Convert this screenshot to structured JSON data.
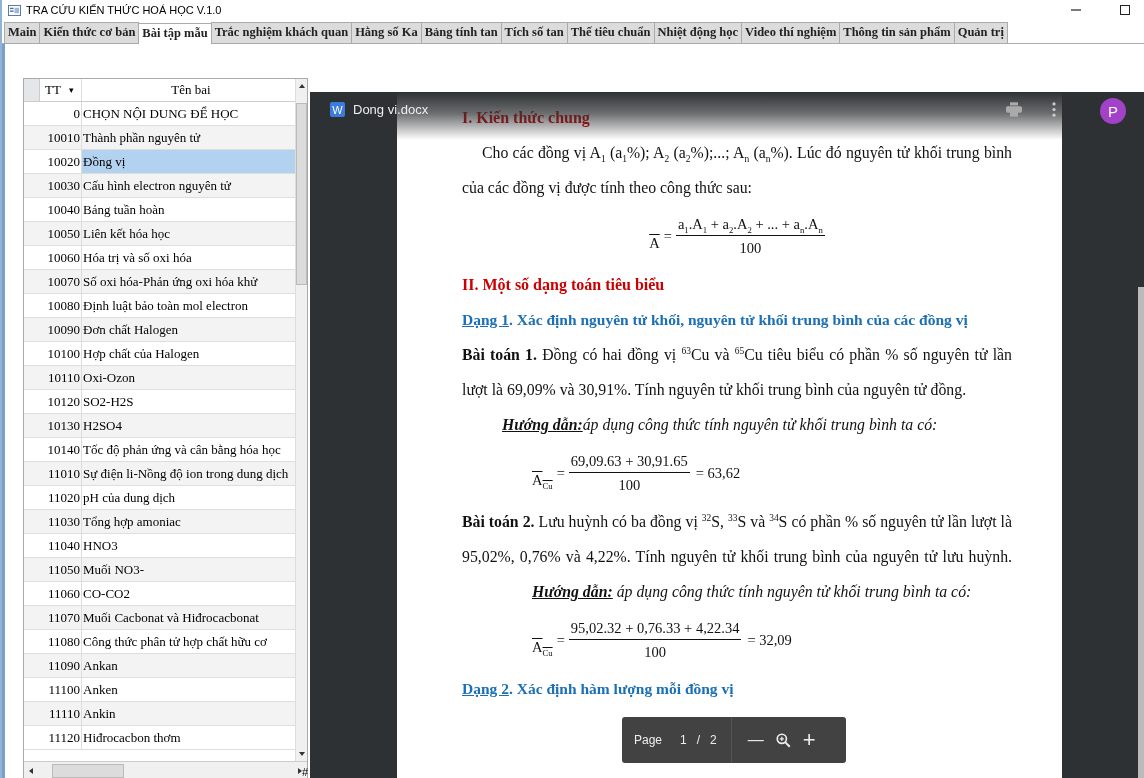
{
  "window": {
    "title": "TRA CỨU KIẾN THỨC HOÁ HỌC V.1.0"
  },
  "tabs": [
    {
      "label": "Main",
      "selected": false
    },
    {
      "label": "Kiến thức cơ bản",
      "selected": false
    },
    {
      "label": "Bài tập mẫu",
      "selected": true
    },
    {
      "label": "Trắc nghiệm khách quan",
      "selected": false
    },
    {
      "label": "Hằng số Ka",
      "selected": false
    },
    {
      "label": "Bảng tính tan",
      "selected": false
    },
    {
      "label": "Tích số tan",
      "selected": false
    },
    {
      "label": "Thế tiêu chuẩn",
      "selected": false
    },
    {
      "label": "Nhiệt động học",
      "selected": false
    },
    {
      "label": "Video thí nghiệm",
      "selected": false
    },
    {
      "label": "Thông tin sản phẩm",
      "selected": false
    },
    {
      "label": "Quản trị",
      "selected": false
    }
  ],
  "table": {
    "columns": [
      {
        "label": "TT",
        "sort_glyph": "▾"
      },
      {
        "label": "Tên bai"
      }
    ],
    "rows": [
      {
        "tt": "0",
        "name": "CHỌN NỘI DUNG ĐỂ HỌC",
        "selected": false
      },
      {
        "tt": "10010",
        "name": "Thành phần nguyên tử",
        "selected": false
      },
      {
        "tt": "10020",
        "name": "Đồng vị",
        "selected": true
      },
      {
        "tt": "10030",
        "name": "Cấu hình electron nguyên tử",
        "selected": false
      },
      {
        "tt": "10040",
        "name": "Bảng tuần hoàn",
        "selected": false
      },
      {
        "tt": "10050",
        "name": "Liên kết hóa học",
        "selected": false
      },
      {
        "tt": "10060",
        "name": "Hóa trị và số oxi hóa",
        "selected": false
      },
      {
        "tt": "10070",
        "name": "Số oxi hóa-Phản ứng oxi hóa khử",
        "selected": false
      },
      {
        "tt": "10080",
        "name": "Định luật bảo toàn mol electron",
        "selected": false
      },
      {
        "tt": "10090",
        "name": "Đơn chất Halogen",
        "selected": false
      },
      {
        "tt": "10100",
        "name": "Hợp chất của Halogen",
        "selected": false
      },
      {
        "tt": "10110",
        "name": "Oxi-Ozon",
        "selected": false
      },
      {
        "tt": "10120",
        "name": "SO2-H2S",
        "selected": false
      },
      {
        "tt": "10130",
        "name": "H2SO4",
        "selected": false
      },
      {
        "tt": "10140",
        "name": "Tốc độ phản ứng và cân bằng hóa học",
        "selected": false
      },
      {
        "tt": "11010",
        "name": "Sự điện li-Nồng độ ion trong dung dịch",
        "selected": false
      },
      {
        "tt": "11020",
        "name": "pH của dung dịch",
        "selected": false
      },
      {
        "tt": "11030",
        "name": "Tổng hợp amoniac",
        "selected": false
      },
      {
        "tt": "11040",
        "name": "HNO3",
        "selected": false
      },
      {
        "tt": "11050",
        "name": "Muối NO3-",
        "selected": false
      },
      {
        "tt": "11060",
        "name": "CO-CO2",
        "selected": false
      },
      {
        "tt": "11070",
        "name": "Muối Cacbonat và Hiđrocacbonat",
        "selected": false
      },
      {
        "tt": "11080",
        "name": "Công thức phân tử hợp chất hữu cơ",
        "selected": false
      },
      {
        "tt": "11090",
        "name": "Ankan",
        "selected": false
      },
      {
        "tt": "11100",
        "name": "Anken",
        "selected": false
      },
      {
        "tt": "11110",
        "name": "Ankin",
        "selected": false
      },
      {
        "tt": "11120",
        "name": "Hiđrocacbon thơm",
        "selected": false
      }
    ]
  },
  "nav_label": "#",
  "viewer": {
    "file_icon_letter": "W",
    "file_name": "Dong vi.docx",
    "avatar": "P",
    "blocks": [
      {
        "kind": "heading",
        "text": "I. Kiến thức chung"
      },
      {
        "kind": "para",
        "text": "Cho các đồng vị A$_{1}$ (a$_{1}$%); A$_{2}$ (a$_{2}$%);...; A$_{n}$ (a$_{n}$%). Lúc đó nguyên tử khối trung bình của các đồng vị được tính theo công thức sau:"
      },
      {
        "kind": "formula",
        "lhs": "A",
        "equals": "=",
        "numerator": "a$_{1}$.A$_{1}$ + a$_{2}$.A$_{2}$ + ... + a$_{n}$.A$_{n}$",
        "denominator": "100"
      },
      {
        "kind": "heading",
        "text": "II. Một số dạng toán tiêu biểu"
      },
      {
        "kind": "section",
        "label": "Dạng 1",
        "text": ". Xác định nguyên tử khối, nguyên tử khối trung bình của các đồng vị"
      },
      {
        "kind": "problem",
        "text": "**Bài toán 1.** Đồng có hai đồng vị $^{63}$Cu và $^{65}$Cu tiêu biểu có phần % số nguyên tử lần lượt là 69,09% và 30,91%. Tính nguyên tử khối trung bình của nguyên tử đồng."
      },
      {
        "kind": "guide",
        "text": "**Hướng dẫn:**áp dụng công thức tính nguyên tử khối trung bình ta có:"
      },
      {
        "kind": "formula",
        "lhs": "A$_{Cu}$",
        "equals": "=",
        "numerator": "69,09.63 + 30,91.65",
        "denominator": "100",
        "result": "= 63,62"
      },
      {
        "kind": "problem",
        "text": "**Bài toán 2.** Lưu huỳnh có ba đồng vị $^{32}$S, $^{33}$S và $^{34}$S có phần % số nguyên tử lần lượt là 95,02%, 0,76% và 4,22%. Tính nguyên tử khối trung bình của nguyên tử lưu huỳnh.",
        "guide": "**Hướng dẫn:** áp dụng công thức tính nguyên tử khối trung bình ta có:"
      },
      {
        "kind": "formula",
        "lhs": "A$_{Cu}$",
        "equals": "=",
        "numerator": "95,02.32 + 0,76.33 + 4,22.34",
        "denominator": "100",
        "result": "= 32,09"
      },
      {
        "kind": "section",
        "label": "Dạng 2",
        "text": ". Xác định hàm lượng mỗi đồng vị"
      }
    ]
  },
  "page_toolbar": {
    "label": "Page",
    "current": "1",
    "separator": "/",
    "total": "2",
    "zoom_out": "—",
    "zoom_in": "+"
  }
}
